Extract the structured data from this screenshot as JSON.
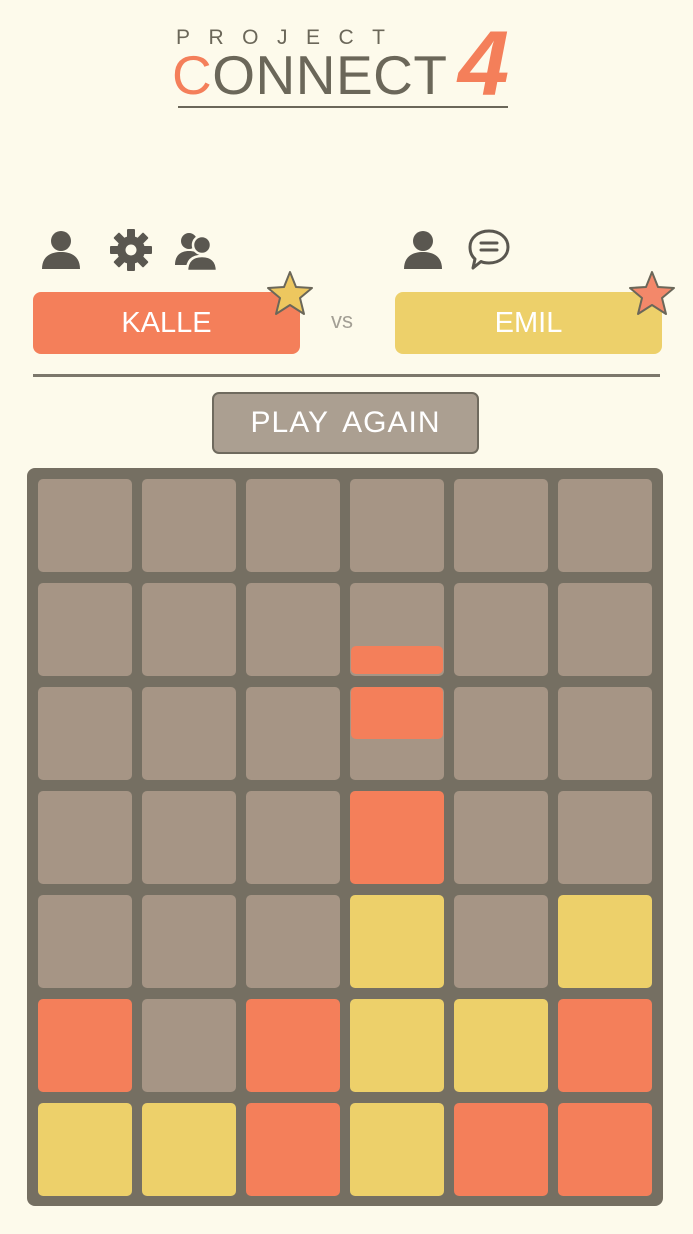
{
  "logo": {
    "project": "PROJECT",
    "connect_first": "C",
    "connect_rest": "ONNECT",
    "number": "4"
  },
  "players": {
    "left": {
      "name": "KALLE",
      "color": "#f47f5a",
      "star_color": "#edc75f",
      "icons": [
        "user-icon",
        "gear-icon",
        "friends-icon"
      ]
    },
    "right": {
      "name": "EMIL",
      "color": "#edd06a",
      "star_color": "#f3886a",
      "icons": [
        "user-icon",
        "chat-bubble-icon"
      ]
    },
    "vs_label": "vs"
  },
  "play_again_label": "PLAY  AGAIN",
  "colors": {
    "red": "#f47f5a",
    "yellow": "#edd06a",
    "empty": "#a69585",
    "board": "#756f62",
    "background": "#fdfaeb"
  },
  "board": {
    "columns": 6,
    "rows": 7,
    "cells": [
      [
        "",
        "",
        "",
        "",
        "",
        ""
      ],
      [
        "",
        "",
        "",
        "",
        "",
        ""
      ],
      [
        "",
        "",
        "",
        "",
        "",
        ""
      ],
      [
        "",
        "",
        "",
        "R",
        "",
        ""
      ],
      [
        "",
        "",
        "",
        "Y",
        "",
        "Y"
      ],
      [
        "R",
        "",
        "R",
        "Y",
        "Y",
        "R"
      ],
      [
        "Y",
        "Y",
        "R",
        "Y",
        "R",
        "R"
      ]
    ],
    "falling_piece": {
      "column": 3,
      "color": "R"
    }
  }
}
